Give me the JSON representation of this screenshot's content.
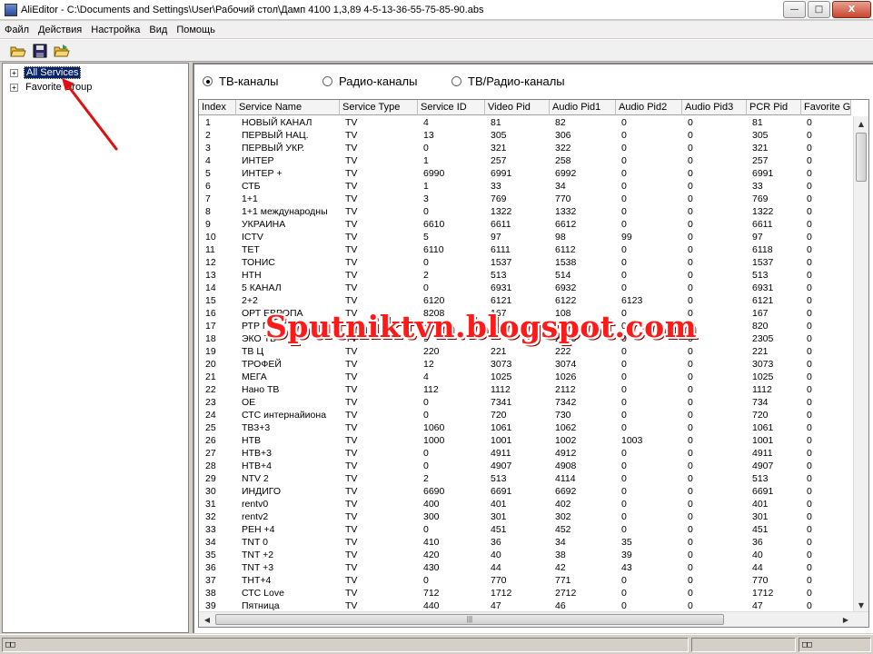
{
  "window": {
    "title": "AliEditor - C:\\Documents and Settings\\User\\Рабочий стол\\Дамп 4100 1,3,89 4-5-13-36-55-75-85-90.abs",
    "minimize_glyph": "—",
    "maximize_glyph": "□",
    "close_glyph": "X"
  },
  "menu": [
    "Файл",
    "Действия",
    "Настройка",
    "Вид",
    "Помощь"
  ],
  "toolbar": {
    "buttons": [
      {
        "name": "open-folder-icon"
      },
      {
        "name": "save-disk-icon"
      },
      {
        "name": "open-file-icon"
      }
    ]
  },
  "tree": {
    "expander": "+",
    "nodes": [
      {
        "label": "All Services",
        "selected": true
      },
      {
        "label": "Favorite Group",
        "selected": false
      }
    ]
  },
  "filters": {
    "options": [
      {
        "label": "ТВ-каналы",
        "checked": true
      },
      {
        "label": "Радио-каналы",
        "checked": false
      },
      {
        "label": "ТВ/Радио-каналы",
        "checked": false
      }
    ]
  },
  "table": {
    "columns": [
      "Index",
      "Service Name",
      "Service Type",
      "Service ID",
      "Video Pid",
      "Audio Pid1",
      "Audio Pid2",
      "Audio Pid3",
      "PCR Pid",
      "Favorite G"
    ],
    "rows": [
      [
        "1",
        "НОВЫЙ КАНАЛ",
        "TV",
        "4",
        "81",
        "82",
        "0",
        "0",
        "81",
        "0"
      ],
      [
        "2",
        "ПЕРВЫЙ НАЦ.",
        "TV",
        "13",
        "305",
        "306",
        "0",
        "0",
        "305",
        "0"
      ],
      [
        "3",
        "ПЕРВЫЙ УКР.",
        "TV",
        "0",
        "321",
        "322",
        "0",
        "0",
        "321",
        "0"
      ],
      [
        "4",
        "ИНТЕР",
        "TV",
        "1",
        "257",
        "258",
        "0",
        "0",
        "257",
        "0"
      ],
      [
        "5",
        "ИНТЕР +",
        "TV",
        "6990",
        "6991",
        "6992",
        "0",
        "0",
        "6991",
        "0"
      ],
      [
        "6",
        "СТБ",
        "TV",
        "1",
        "33",
        "34",
        "0",
        "0",
        "33",
        "0"
      ],
      [
        "7",
        "1+1",
        "TV",
        "3",
        "769",
        "770",
        "0",
        "0",
        "769",
        "0"
      ],
      [
        "8",
        "1+1 международны",
        "TV",
        "0",
        "1322",
        "1332",
        "0",
        "0",
        "1322",
        "0"
      ],
      [
        "9",
        "УКРАИНА",
        "TV",
        "6610",
        "6611",
        "6612",
        "0",
        "0",
        "6611",
        "0"
      ],
      [
        "10",
        "ICTV",
        "TV",
        "5",
        "97",
        "98",
        "99",
        "0",
        "97",
        "0"
      ],
      [
        "11",
        "ТЕТ",
        "TV",
        "6110",
        "6111",
        "6112",
        "0",
        "0",
        "6118",
        "0"
      ],
      [
        "12",
        "ТОНИС",
        "TV",
        "0",
        "1537",
        "1538",
        "0",
        "0",
        "1537",
        "0"
      ],
      [
        "13",
        "НТН",
        "TV",
        "2",
        "513",
        "514",
        "0",
        "0",
        "513",
        "0"
      ],
      [
        "14",
        "5 КАНАЛ",
        "TV",
        "0",
        "6931",
        "6932",
        "0",
        "0",
        "6931",
        "0"
      ],
      [
        "15",
        "2+2",
        "TV",
        "6120",
        "6121",
        "6122",
        "6123",
        "0",
        "6121",
        "0"
      ],
      [
        "16",
        "ОРТ ЕВРОПА",
        "TV",
        "8208",
        "167",
        "108",
        "0",
        "0",
        "167",
        "0"
      ],
      [
        "17",
        "РТР П",
        "TV",
        "",
        "",
        "",
        "0",
        "0",
        "820",
        "0"
      ],
      [
        "18",
        "ЭКО ТВ",
        "TV",
        "9",
        "",
        "2306",
        "0",
        "0",
        "2305",
        "0"
      ],
      [
        "19",
        "ТВ Ц",
        "TV",
        "220",
        "221",
        "222",
        "0",
        "0",
        "221",
        "0"
      ],
      [
        "20",
        "ТРОФЕЙ",
        "TV",
        "12",
        "3073",
        "3074",
        "0",
        "0",
        "3073",
        "0"
      ],
      [
        "21",
        "МЕГА",
        "TV",
        "4",
        "1025",
        "1026",
        "0",
        "0",
        "1025",
        "0"
      ],
      [
        "22",
        "Нано ТВ",
        "TV",
        "112",
        "1112",
        "2112",
        "0",
        "0",
        "1112",
        "0"
      ],
      [
        "23",
        "ОЕ",
        "TV",
        "0",
        "7341",
        "7342",
        "0",
        "0",
        "734",
        "0"
      ],
      [
        "24",
        "СТС интернайиона",
        "TV",
        "0",
        "720",
        "730",
        "0",
        "0",
        "720",
        "0"
      ],
      [
        "25",
        "ТВ3+3",
        "TV",
        "1060",
        "1061",
        "1062",
        "0",
        "0",
        "1061",
        "0"
      ],
      [
        "26",
        "НТВ",
        "TV",
        "1000",
        "1001",
        "1002",
        "1003",
        "0",
        "1001",
        "0"
      ],
      [
        "27",
        "НТВ+3",
        "TV",
        "0",
        "4911",
        "4912",
        "0",
        "0",
        "4911",
        "0"
      ],
      [
        "28",
        "НТВ+4",
        "TV",
        "0",
        "4907",
        "4908",
        "0",
        "0",
        "4907",
        "0"
      ],
      [
        "29",
        "NTV 2",
        "TV",
        "2",
        "513",
        "4114",
        "0",
        "0",
        "513",
        "0"
      ],
      [
        "30",
        "ИНДИГО",
        "TV",
        "6690",
        "6691",
        "6692",
        "0",
        "0",
        "6691",
        "0"
      ],
      [
        "31",
        "rentv0",
        "TV",
        "400",
        "401",
        "402",
        "0",
        "0",
        "401",
        "0"
      ],
      [
        "32",
        "rentv2",
        "TV",
        "300",
        "301",
        "302",
        "0",
        "0",
        "301",
        "0"
      ],
      [
        "33",
        "РЕН +4",
        "TV",
        "0",
        "451",
        "452",
        "0",
        "0",
        "451",
        "0"
      ],
      [
        "34",
        "TNT 0",
        "TV",
        "410",
        "36",
        "34",
        "35",
        "0",
        "36",
        "0"
      ],
      [
        "35",
        "TNT +2",
        "TV",
        "420",
        "40",
        "38",
        "39",
        "0",
        "40",
        "0"
      ],
      [
        "36",
        "TNT +3",
        "TV",
        "430",
        "44",
        "42",
        "43",
        "0",
        "44",
        "0"
      ],
      [
        "37",
        "ТНТ+4",
        "TV",
        "0",
        "770",
        "771",
        "0",
        "0",
        "770",
        "0"
      ],
      [
        "38",
        "СТС Love",
        "TV",
        "712",
        "1712",
        "2712",
        "0",
        "0",
        "1712",
        "0"
      ],
      [
        "39",
        "Пятница",
        "TV",
        "440",
        "47",
        "46",
        "0",
        "0",
        "47",
        "0"
      ]
    ]
  },
  "statusbar": {
    "left": "□□",
    "right1": "",
    "right2": "□□"
  },
  "watermark": "Sputniktvn.blogspot.com",
  "colors": {
    "selection": "#0a246a",
    "watermark": "#ff1a1a",
    "annotation_arrow": "#e01010"
  }
}
